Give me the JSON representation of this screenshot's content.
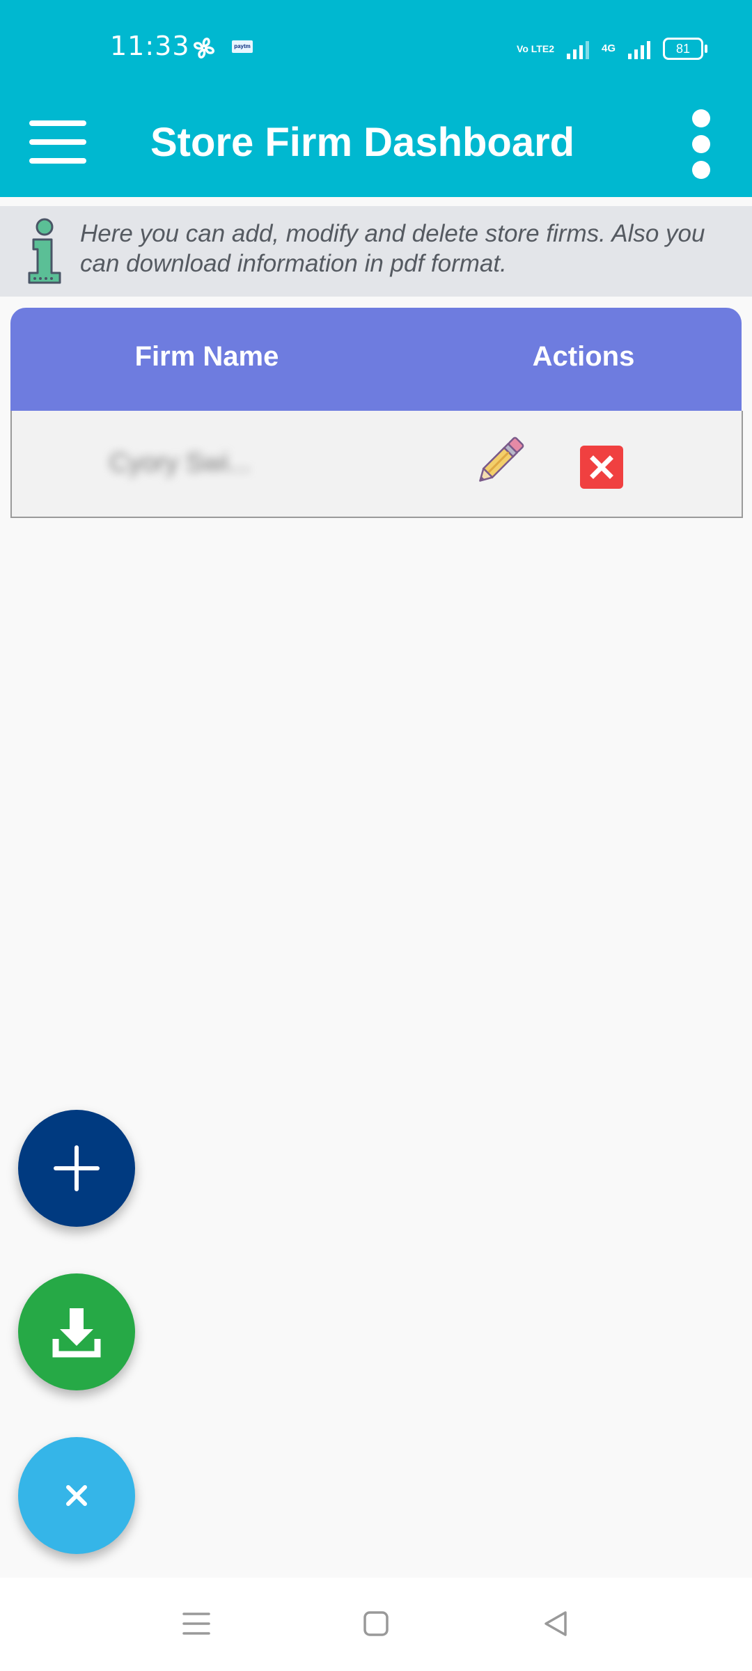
{
  "status_bar": {
    "time": "11:33",
    "volte_label": "Vo LTE2",
    "network_label": "4G",
    "battery_level": "81"
  },
  "app_bar": {
    "title": "Store Firm Dashboard",
    "menu_icon": "hamburger-icon",
    "more_icon": "more-vert-icon"
  },
  "info": {
    "icon": "info-icon",
    "text": "Here you can add, modify and delete store firms. Also you can download information in pdf format."
  },
  "table": {
    "columns": [
      "Firm Name",
      "Actions"
    ],
    "rows": [
      {
        "firm_name": "Cyory Swi..."
      }
    ]
  },
  "fabs": [
    {
      "icon": "plus-icon",
      "color": "#003a80"
    },
    {
      "icon": "download-icon",
      "color": "#26a946"
    },
    {
      "icon": "close-icon",
      "color": "#35b5e8"
    }
  ],
  "colors": {
    "accent": "#00b8d0",
    "table_header": "#6e7cdf",
    "delete": "#f04040"
  }
}
